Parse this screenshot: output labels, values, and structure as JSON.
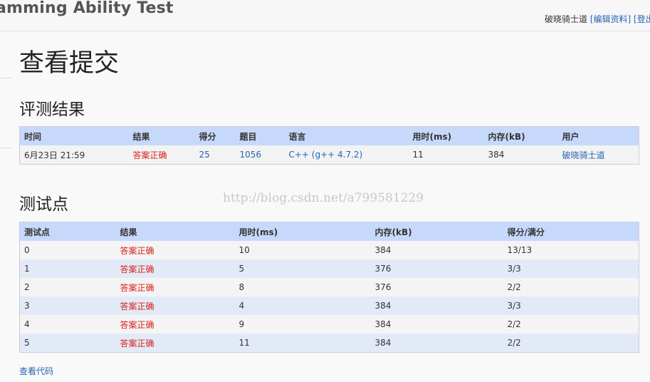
{
  "header": {
    "brand": "amming Ability Test",
    "username": "破晓骑士道",
    "edit_profile": "[编辑资料]",
    "logout": "[登出"
  },
  "page_title": "查看提交",
  "judge_section": {
    "title": "评测结果",
    "columns": [
      "时间",
      "结果",
      "得分",
      "题目",
      "语言",
      "用时(ms)",
      "内存(kB)",
      "用户"
    ],
    "row": {
      "time": "6月23日 21:59",
      "result": "答案正确",
      "score": "25",
      "problem": "1056",
      "language": "C++ (g++ 4.7.2)",
      "time_ms": "11",
      "memory_kb": "384",
      "user": "破晓骑士道"
    }
  },
  "tests_section": {
    "title": "测试点",
    "columns": [
      "测试点",
      "结果",
      "用时(ms)",
      "内存(kB)",
      "得分/满分"
    ],
    "rows": [
      {
        "case": "0",
        "result": "答案正确",
        "time": "10",
        "memory": "384",
        "score": "13/13"
      },
      {
        "case": "1",
        "result": "答案正确",
        "time": "5",
        "memory": "376",
        "score": "3/3"
      },
      {
        "case": "2",
        "result": "答案正确",
        "time": "8",
        "memory": "376",
        "score": "2/2"
      },
      {
        "case": "3",
        "result": "答案正确",
        "time": "4",
        "memory": "384",
        "score": "3/3"
      },
      {
        "case": "4",
        "result": "答案正确",
        "time": "9",
        "memory": "384",
        "score": "2/2"
      },
      {
        "case": "5",
        "result": "答案正确",
        "time": "11",
        "memory": "384",
        "score": "2/2"
      }
    ]
  },
  "watermark": "http://blog.csdn.net/a799581229",
  "view_code": "查看代码",
  "colors": {
    "header_row": "#c7d9fb",
    "link": "#2864b4",
    "accepted": "#d9231b"
  }
}
